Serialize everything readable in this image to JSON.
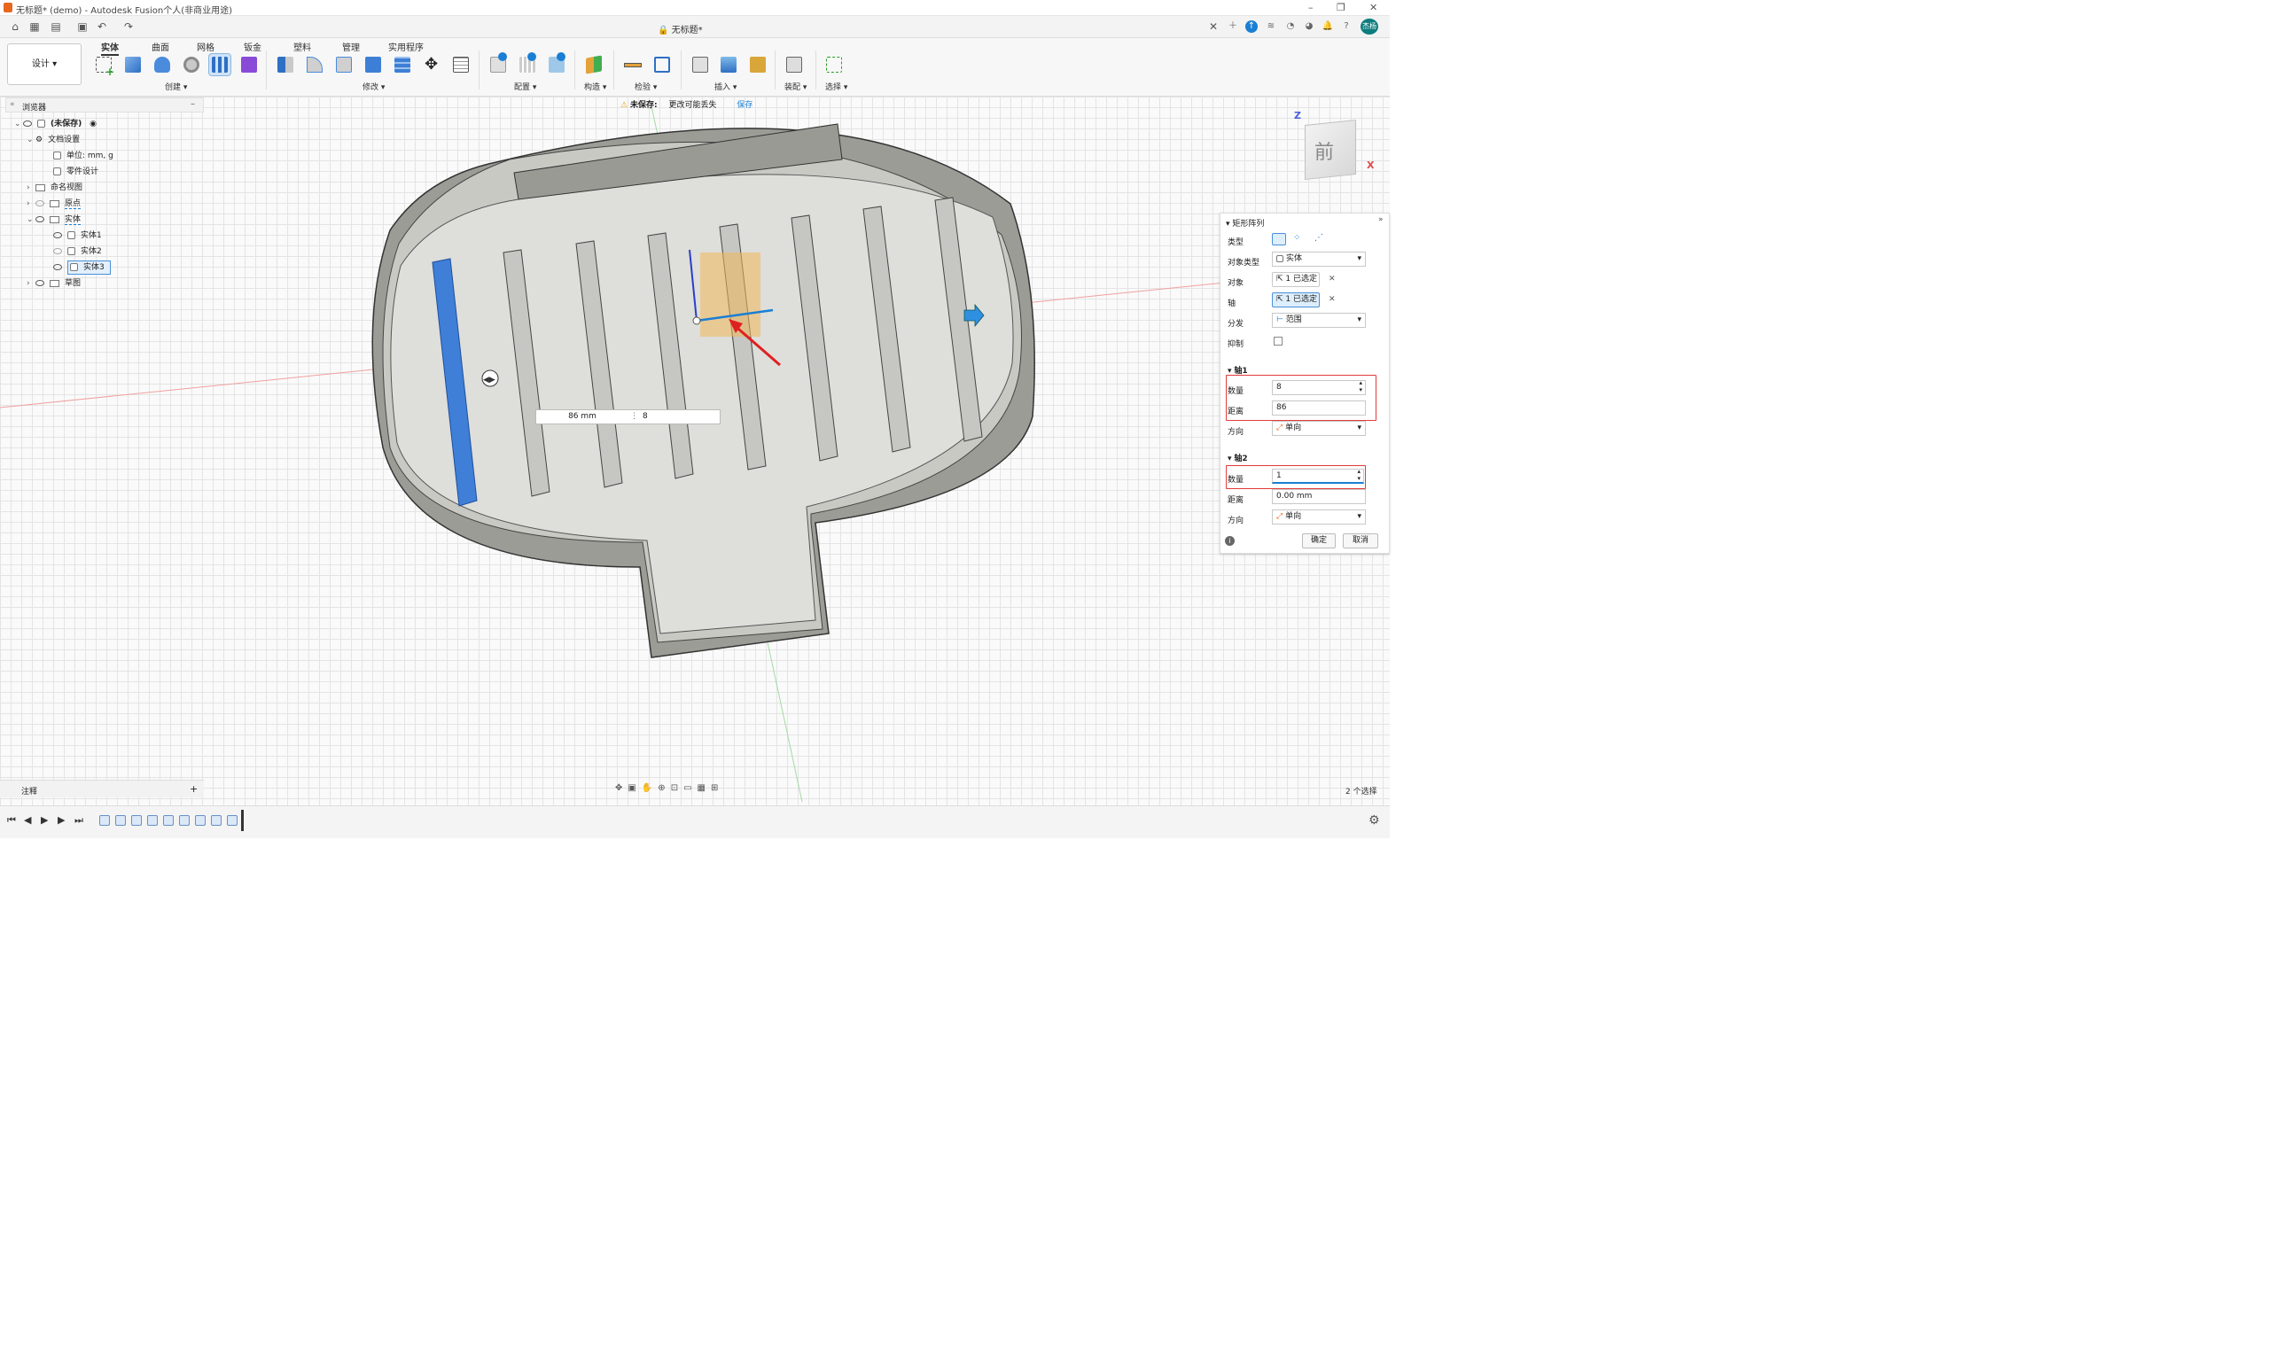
{
  "window": {
    "title": "无标题* (demo) - Autodesk Fusion个人(非商业用途)",
    "controls": [
      "–",
      "❐",
      "✕"
    ]
  },
  "doc_tab": {
    "title": "无标题*",
    "lock_icon": "lock-icon",
    "close": "✕"
  },
  "user": {
    "avatar_text": "杰杨"
  },
  "ribbon": {
    "workspace": "设计",
    "tabs": [
      "实体",
      "曲面",
      "网格",
      "钣金",
      "塑料",
      "管理",
      "实用程序"
    ],
    "active_tab": "实体",
    "groups": [
      "创建",
      "修改",
      "配置",
      "构造",
      "检验",
      "插入",
      "装配",
      "选择"
    ]
  },
  "browser": {
    "title": "浏览器",
    "nodes": [
      {
        "label": "(未保存)",
        "level": 0
      },
      {
        "label": "文档设置",
        "level": 1
      },
      {
        "label": "单位: mm, g",
        "level": 2
      },
      {
        "label": "零件设计",
        "level": 2
      },
      {
        "label": "命名视图",
        "level": 1
      },
      {
        "label": "原点",
        "level": 1
      },
      {
        "label": "实体",
        "level": 1
      },
      {
        "label": "实体1",
        "level": 2
      },
      {
        "label": "实体2",
        "level": 2
      },
      {
        "label": "实体3",
        "level": 2
      },
      {
        "label": "草图",
        "level": 1
      }
    ]
  },
  "unsaved_bar": {
    "label": "未保存:",
    "message": "更改可能丢失",
    "save": "保存"
  },
  "viewcube": {
    "face": "前",
    "axis_z": "Z",
    "axis_x": "X"
  },
  "inline_inputs": {
    "distance": "86 mm",
    "count": "8"
  },
  "panel": {
    "title": "矩形阵列",
    "type_label": "类型",
    "object_type_label": "对象类型",
    "object_type_value": "实体",
    "objects_label": "对象",
    "objects_value": "1 已选定",
    "axis_label": "轴",
    "axis_value": "1 已选定",
    "distribution_label": "分发",
    "distribution_value": "范围",
    "suppress_label": "抑制",
    "axis1": {
      "header": "轴1",
      "quantity_label": "数量",
      "quantity": "8",
      "distance_label": "距离",
      "distance": "86",
      "direction_label": "方向",
      "direction": "单向"
    },
    "axis2": {
      "header": "轴2",
      "quantity_label": "数量",
      "quantity": "1",
      "distance_label": "距离",
      "distance": "0.00 mm",
      "direction_label": "方向",
      "direction": "单向"
    },
    "ok": "确定",
    "cancel": "取消"
  },
  "bottom": {
    "comments": "注释",
    "selection_count": "2 个选择"
  },
  "colors": {
    "selected_body": "#3f7fd8",
    "highlight_red": "#e23b3b",
    "accent_blue": "#1a7fd4"
  }
}
